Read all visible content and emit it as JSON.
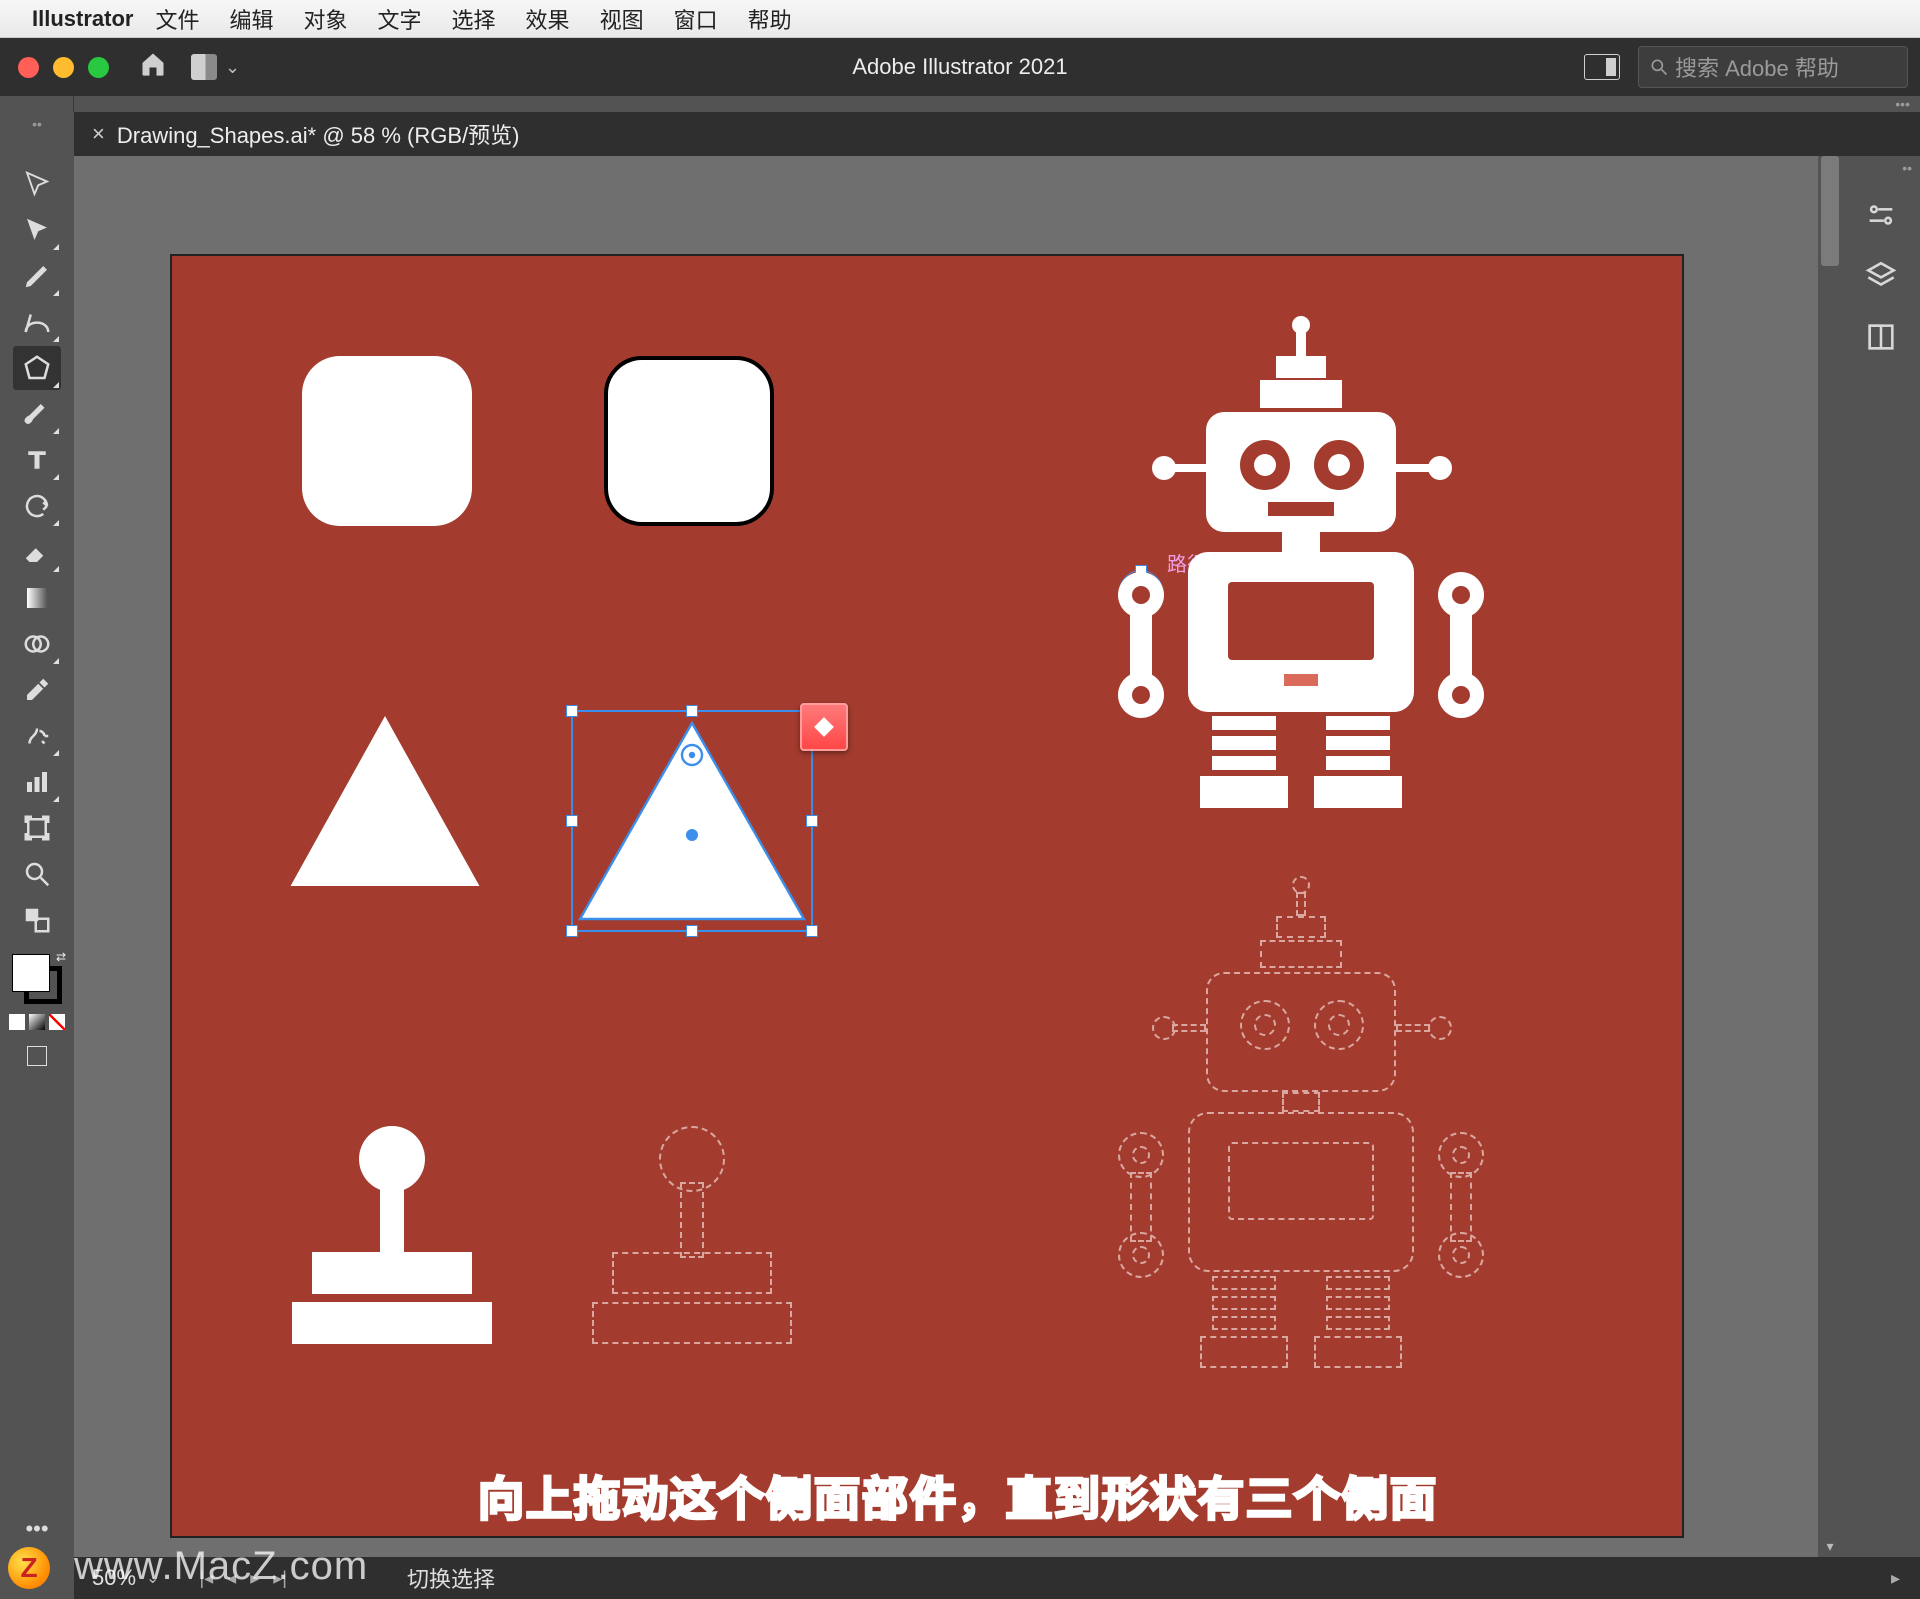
{
  "mac_menu": {
    "app": "Illustrator",
    "items": [
      "文件",
      "编辑",
      "对象",
      "文字",
      "选择",
      "效果",
      "视图",
      "窗口",
      "帮助"
    ]
  },
  "titlebar": {
    "app_title": "Adobe Illustrator 2021",
    "search_placeholder": "搜索 Adobe 帮助"
  },
  "document": {
    "tab_label": "Drawing_Shapes.ai* @ 58 % (RGB/预览)",
    "close_glyph": "×"
  },
  "tools": {
    "selection": "选择工具",
    "direct": "直接选择工具",
    "pen": "钢笔工具",
    "curvature": "曲率工具",
    "polygon": "多边形工具",
    "brush": "画笔工具",
    "type": "文字工具",
    "rotate": "旋转工具",
    "eraser": "橡皮擦工具",
    "gradient": "渐变工具",
    "shapebuilder": "形状生成器工具",
    "eyedropper": "吸管工具",
    "symbol": "符号喷枪工具",
    "graph": "图表工具",
    "artboard": "画板工具",
    "zoom": "缩放工具",
    "fillstroke": "填色和描边"
  },
  "tooltip": {
    "path_label": "路径"
  },
  "right_panels": {
    "properties": "属性",
    "layers": "图层",
    "libraries": "库"
  },
  "statusbar": {
    "zoom_display": "50%",
    "mode": "切换选择"
  },
  "caption": "向上拖动这个侧面部件，直到形状有三个侧面",
  "watermark": "www.MacZ.com",
  "watermark_badge": "Z",
  "colors": {
    "artboard_bg": "#a33c2e",
    "selection_blue": "#3b8eeb",
    "widget_red": "#ff4d4d"
  },
  "selected_shape": {
    "type": "polygon",
    "sides": 3,
    "widget": "side-count"
  }
}
